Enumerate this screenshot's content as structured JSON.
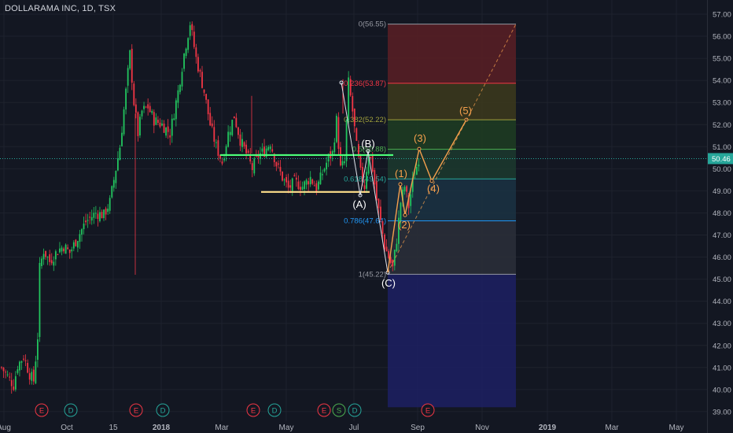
{
  "header": {
    "title": "DOLLARAMA INC, 1D, TSX"
  },
  "price_label": "50.46",
  "chart_data": {
    "type": "candlestick",
    "title": "DOLLARAMA INC, 1D, TSX",
    "ylim": [
      38.7,
      57.4
    ],
    "yticks": [
      "39.00",
      "40.00",
      "41.00",
      "42.00",
      "43.00",
      "44.00",
      "45.00",
      "46.00",
      "47.00",
      "48.00",
      "49.00",
      "50.00",
      "51.00",
      "52.00",
      "53.00",
      "54.00",
      "55.00",
      "56.00",
      "57.00"
    ],
    "xticks": [
      "Aug",
      "Oct",
      "15",
      "2018",
      "Mar",
      "May",
      "Jul",
      "Sep",
      "Nov",
      "2019",
      "Mar",
      "May"
    ],
    "last_price": 50.46,
    "fib_levels": [
      {
        "label": "0(56.55)",
        "value": 56.55,
        "color": "#9598a1",
        "band": "#5a1f24"
      },
      {
        "label": "0.236(53.87)",
        "value": 53.87,
        "color": "#f23645",
        "band": "#3d3a1c"
      },
      {
        "label": "0.382(52.22)",
        "value": 52.22,
        "color": "#a0a03c",
        "band": "#1f3d22"
      },
      {
        "label": "0.5(50.88)",
        "value": 50.88,
        "color": "#4caf50",
        "band": "#1c3a2e"
      },
      {
        "label": "0.618(49.54)",
        "value": 49.54,
        "color": "#26a69a",
        "band": "#1b3243"
      },
      {
        "label": "0.786(47.64)",
        "value": 47.64,
        "color": "#2196f3",
        "band": "#2c2f3a"
      },
      {
        "label": "1(45.22)",
        "value": 45.22,
        "color": "#9598a1",
        "band": "#1d2063"
      }
    ],
    "wave_labels": [
      "(A)",
      "(B)",
      "(C)",
      "(1)",
      "(2)",
      "(3)",
      "(4)",
      "(5)"
    ],
    "events": [
      "E",
      "D",
      "E",
      "D",
      "E",
      "D",
      "E",
      "S",
      "D",
      "E"
    ],
    "support_line": 48.95,
    "resistance_line": 50.62
  }
}
